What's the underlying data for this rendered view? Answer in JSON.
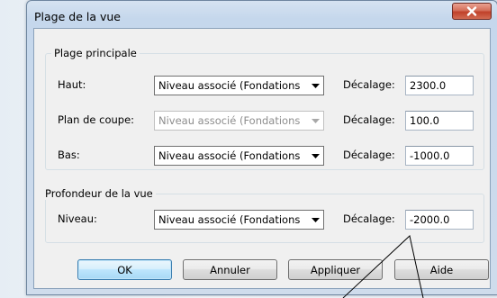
{
  "window": {
    "title": "Plage de la vue"
  },
  "primary_range": {
    "group_label": "Plage principale",
    "rows": [
      {
        "label": "Haut:",
        "level": "Niveau associé (Fondations",
        "offset_label": "Décalage:",
        "offset": "2300.0"
      },
      {
        "label": "Plan de coupe:",
        "level": "Niveau associé (Fondations",
        "offset_label": "Décalage:",
        "offset": "100.0"
      },
      {
        "label": "Bas:",
        "level": "Niveau associé (Fondations",
        "offset_label": "Décalage:",
        "offset": "-1000.0"
      }
    ]
  },
  "view_depth": {
    "group_label": "Profondeur de la vue",
    "row": {
      "label": "Niveau:",
      "level": "Niveau associé (Fondations",
      "offset_label": "Décalage:",
      "offset": "-2000.0"
    }
  },
  "buttons": {
    "ok": "OK",
    "cancel": "Annuler",
    "apply": "Appliquer",
    "help": "Aide"
  },
  "colors": {
    "close_button": "#c0412a",
    "default_button_border": "#3c7fb1"
  },
  "icons": {
    "close": "close-icon",
    "dropdown": "chevron-down-icon"
  }
}
